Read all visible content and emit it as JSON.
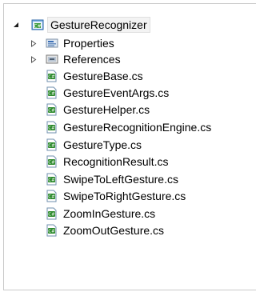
{
  "tree": {
    "root": {
      "label": "GestureRecognizer",
      "icon": "csharp-project-icon",
      "expanded": true
    },
    "folders": [
      {
        "label": "Properties",
        "icon": "properties-folder-icon",
        "expanded": false
      },
      {
        "label": "References",
        "icon": "references-folder-icon",
        "expanded": false
      }
    ],
    "files": [
      {
        "label": "GestureBase.cs",
        "icon": "csharp-file-icon"
      },
      {
        "label": "GestureEventArgs.cs",
        "icon": "csharp-file-icon"
      },
      {
        "label": "GestureHelper.cs",
        "icon": "csharp-file-icon"
      },
      {
        "label": "GestureRecognitionEngine.cs",
        "icon": "csharp-file-icon"
      },
      {
        "label": "GestureType.cs",
        "icon": "csharp-file-icon"
      },
      {
        "label": "RecognitionResult.cs",
        "icon": "csharp-file-icon"
      },
      {
        "label": "SwipeToLeftGesture.cs",
        "icon": "csharp-file-icon"
      },
      {
        "label": "SwipeToRightGesture.cs",
        "icon": "csharp-file-icon"
      },
      {
        "label": "ZoomInGesture.cs",
        "icon": "csharp-file-icon"
      },
      {
        "label": "ZoomOutGesture.cs",
        "icon": "csharp-file-icon"
      }
    ]
  }
}
